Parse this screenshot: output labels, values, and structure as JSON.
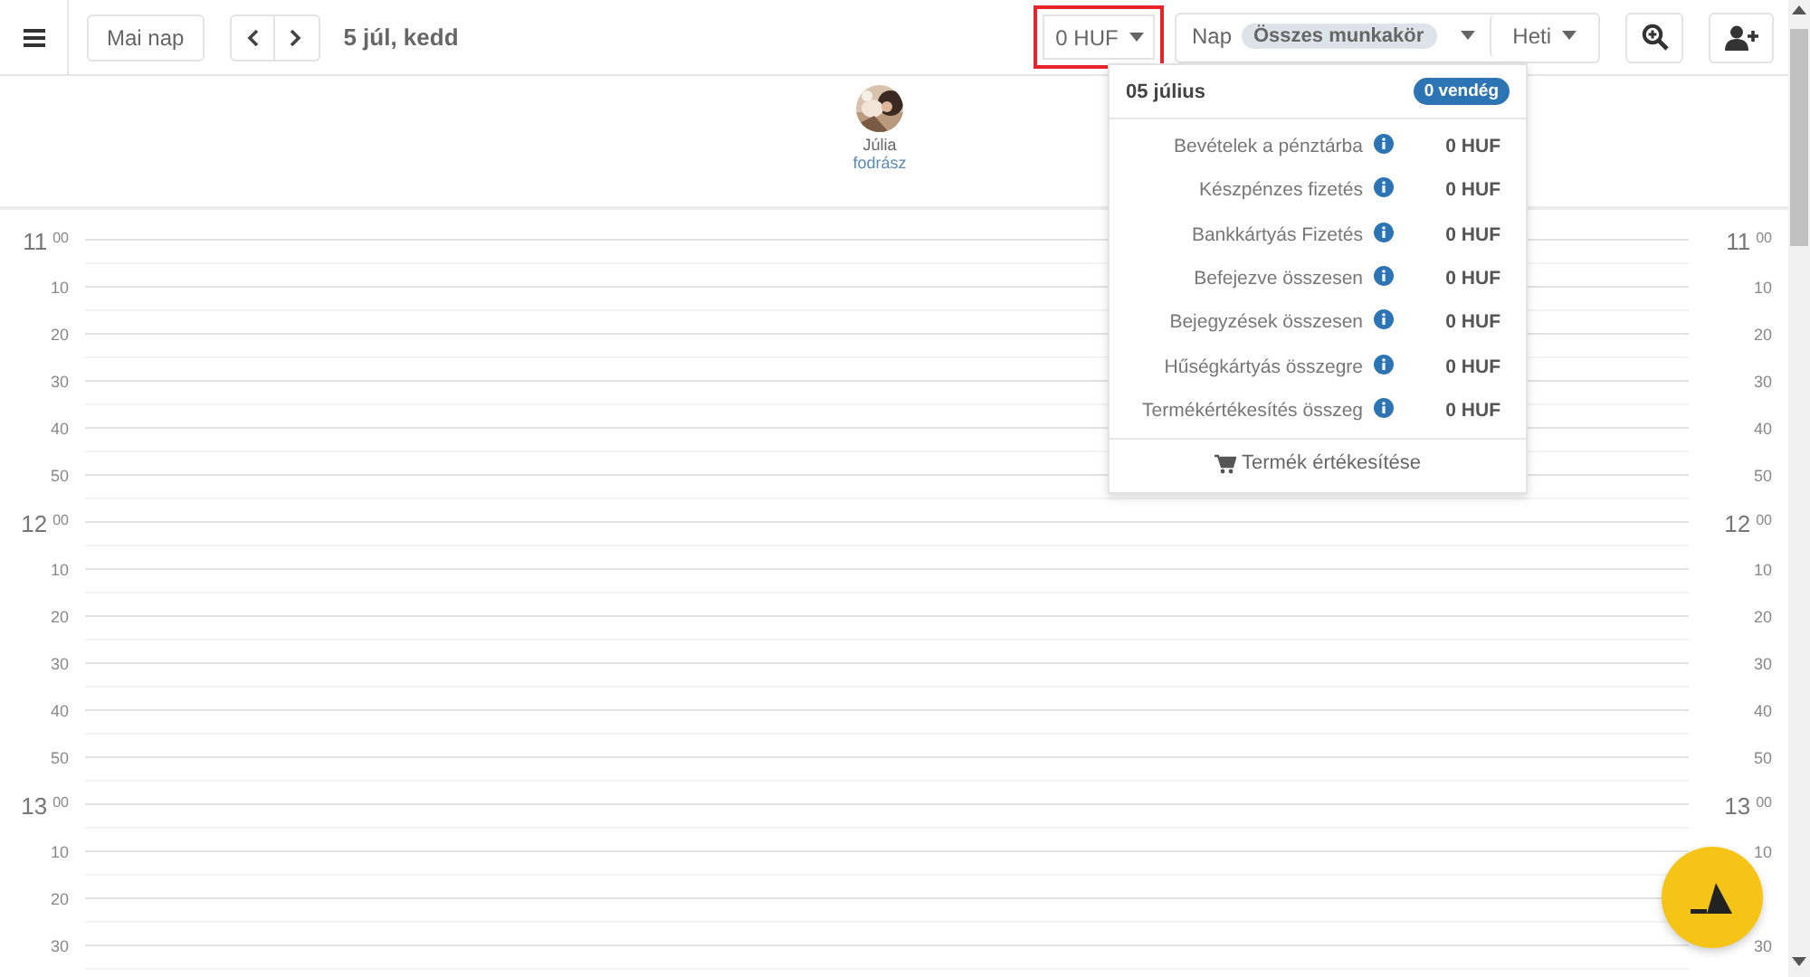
{
  "toolbar": {
    "today_button": "Mai nap",
    "date": "5 júl, kedd",
    "revenue_button": {
      "label": "0 HUF",
      "highlighted": true
    },
    "view": {
      "label": "Nap",
      "filter": "Összes munkakör"
    },
    "range_button": "Heti"
  },
  "staff": [
    {
      "name": "Júlia",
      "role": "fodrász"
    }
  ],
  "slots": [
    {
      "kind": "hour",
      "hour": "11",
      "minute": "00",
      "right_hour": "11",
      "right_minute": "00"
    },
    {
      "kind": "minute",
      "minute": "10",
      "right_minute": "10"
    },
    {
      "kind": "minute",
      "minute": "20",
      "right_minute": "20"
    },
    {
      "kind": "minute",
      "minute": "30",
      "right_minute": "30"
    },
    {
      "kind": "minute",
      "minute": "40",
      "right_minute": "40"
    },
    {
      "kind": "minute",
      "minute": "50",
      "right_minute": "50"
    },
    {
      "kind": "hour",
      "hour": "12",
      "minute": "00",
      "right_hour": "12",
      "right_minute": "00"
    },
    {
      "kind": "minute",
      "minute": "10",
      "right_minute": "10"
    },
    {
      "kind": "minute",
      "minute": "20",
      "right_minute": "20"
    },
    {
      "kind": "minute",
      "minute": "30",
      "right_minute": "30"
    },
    {
      "kind": "minute",
      "minute": "40",
      "right_minute": "40"
    },
    {
      "kind": "minute",
      "minute": "50",
      "right_minute": "50"
    },
    {
      "kind": "hour",
      "hour": "13",
      "minute": "00",
      "right_hour": "13",
      "right_minute": "00"
    },
    {
      "kind": "minute",
      "minute": "10",
      "right_minute": "10"
    },
    {
      "kind": "minute",
      "minute": "20"
    },
    {
      "kind": "minute",
      "minute": "30",
      "right_minute": "30"
    }
  ],
  "summary_popup": {
    "date": "05 július",
    "guests_badge": "0 vendég",
    "rows": [
      {
        "label": "Bevételek a pénztárba",
        "value": "0 HUF"
      },
      {
        "label": "Készpénzes fizetés",
        "value": "0 HUF"
      },
      {
        "label": "Bankkártyás Fizetés",
        "value": "0 HUF"
      },
      {
        "label": "Befejezve összesen",
        "value": "0 HUF"
      },
      {
        "label": "Bejegyzések összesen",
        "value": "0 HUF"
      },
      {
        "label": "Hűségkártyás összegre",
        "value": "0 HUF"
      },
      {
        "label": "Termékértékesítés összeg",
        "value": "0 HUF"
      }
    ],
    "footer_button": "Termék értékesítése"
  }
}
